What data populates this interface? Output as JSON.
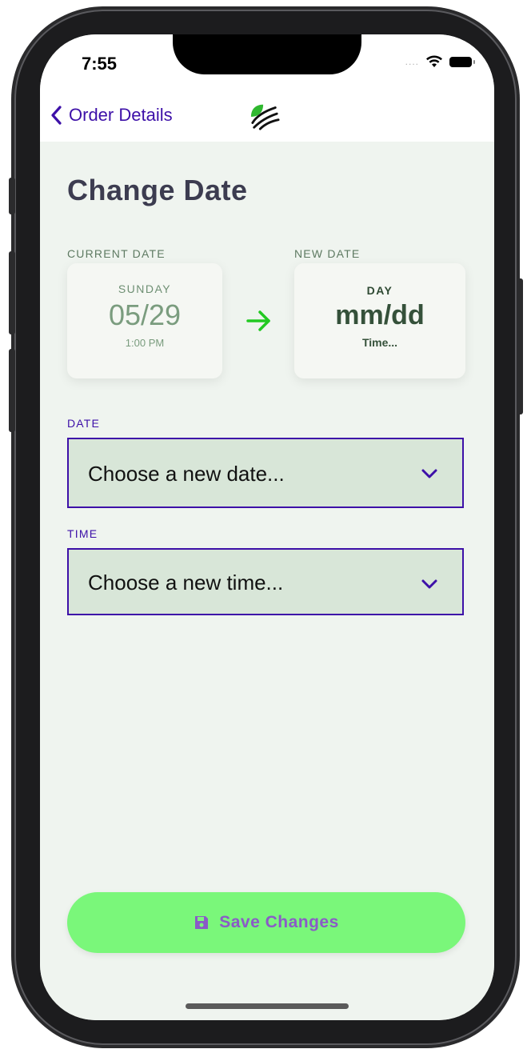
{
  "status_bar": {
    "time": "7:55",
    "signal": "....",
    "wifi_icon": "wifi-icon",
    "battery_icon": "battery-icon"
  },
  "nav": {
    "back_label": "Order Details",
    "back_icon": "chevron-left-icon",
    "logo_icon": "leaf-stripes-logo"
  },
  "page": {
    "title": "Change Date"
  },
  "current_date": {
    "label": "CURRENT DATE",
    "day": "SUNDAY",
    "date": "05/29",
    "time": "1:00 PM"
  },
  "new_date": {
    "label": "NEW DATE",
    "day": "DAY",
    "date": "mm/dd",
    "time": "Time..."
  },
  "arrow_icon": "arrow-right-icon",
  "date_field": {
    "label": "DATE",
    "value": "Choose a new date..."
  },
  "time_field": {
    "label": "TIME",
    "value": "Choose a new time..."
  },
  "save_button": {
    "label": "Save Changes",
    "icon": "floppy-disk-icon"
  },
  "colors": {
    "accent": "#3d10a8",
    "save_bg": "#7af77a",
    "save_text": "#8a5bc7",
    "page_bg": "#eff4ef",
    "arrow": "#22c922"
  }
}
